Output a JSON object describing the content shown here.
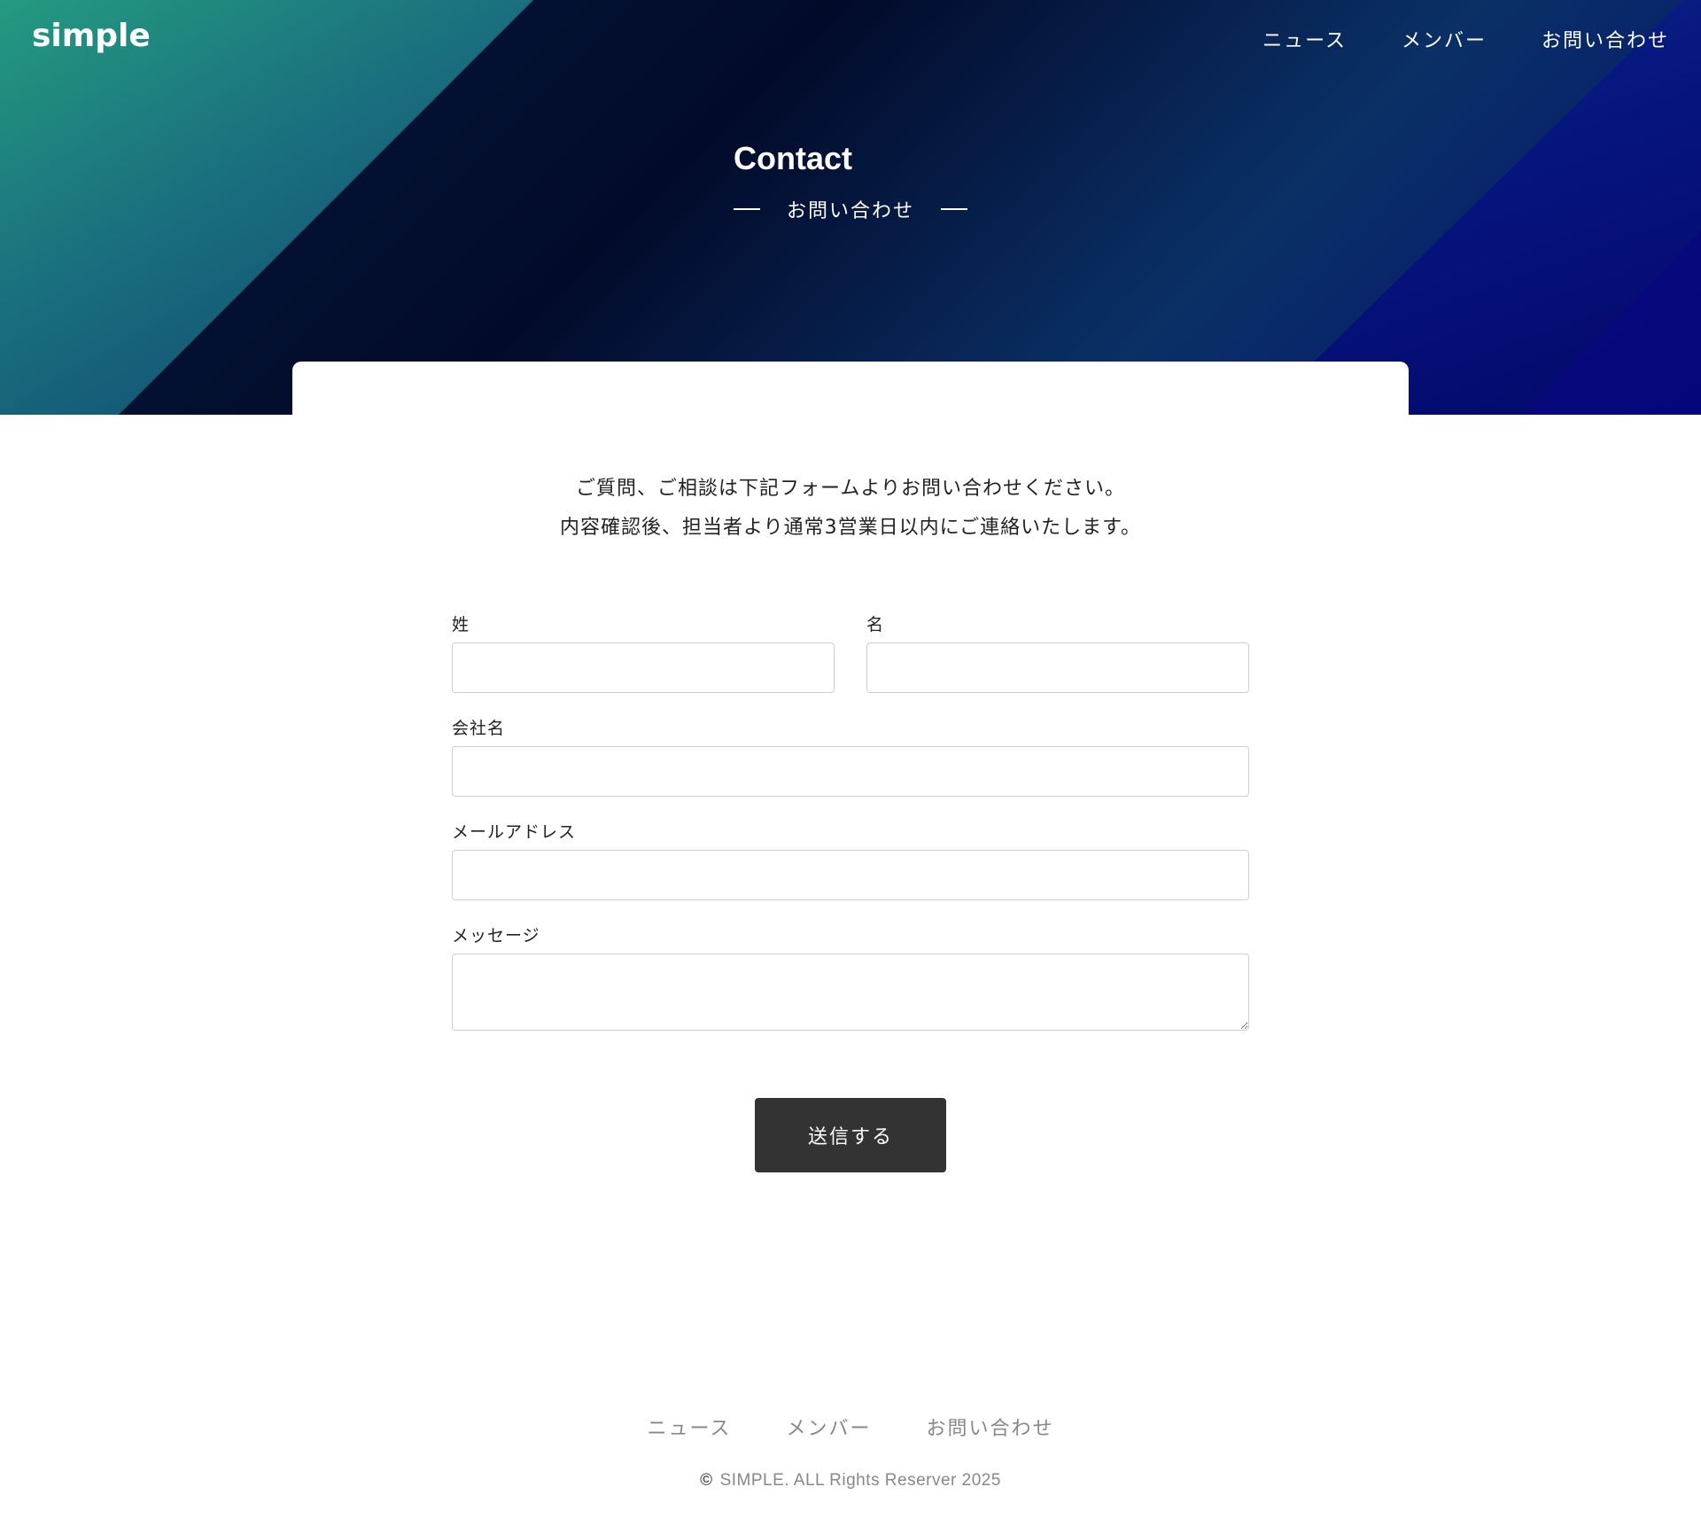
{
  "header": {
    "logo": "simple",
    "nav": [
      "ニュース",
      "メンバー",
      "お問い合わせ"
    ]
  },
  "hero": {
    "title": "Contact",
    "subtitle": "お問い合わせ"
  },
  "intro": {
    "line1": "ご質問、ご相談は下記フォームよりお問い合わせください。",
    "line2": "内容確認後、担当者より通常3営業日以内にご連絡いたします。"
  },
  "form": {
    "last_name_label": "姓",
    "first_name_label": "名",
    "company_label": "会社名",
    "email_label": "メールアドレス",
    "message_label": "メッセージ",
    "submit_label": "送信する"
  },
  "footer": {
    "nav": [
      "ニュース",
      "メンバー",
      "お問い合わせ"
    ],
    "copyright_symbol": "©",
    "copyright": "SIMPLE. ALL Rights Reserver 2025"
  }
}
